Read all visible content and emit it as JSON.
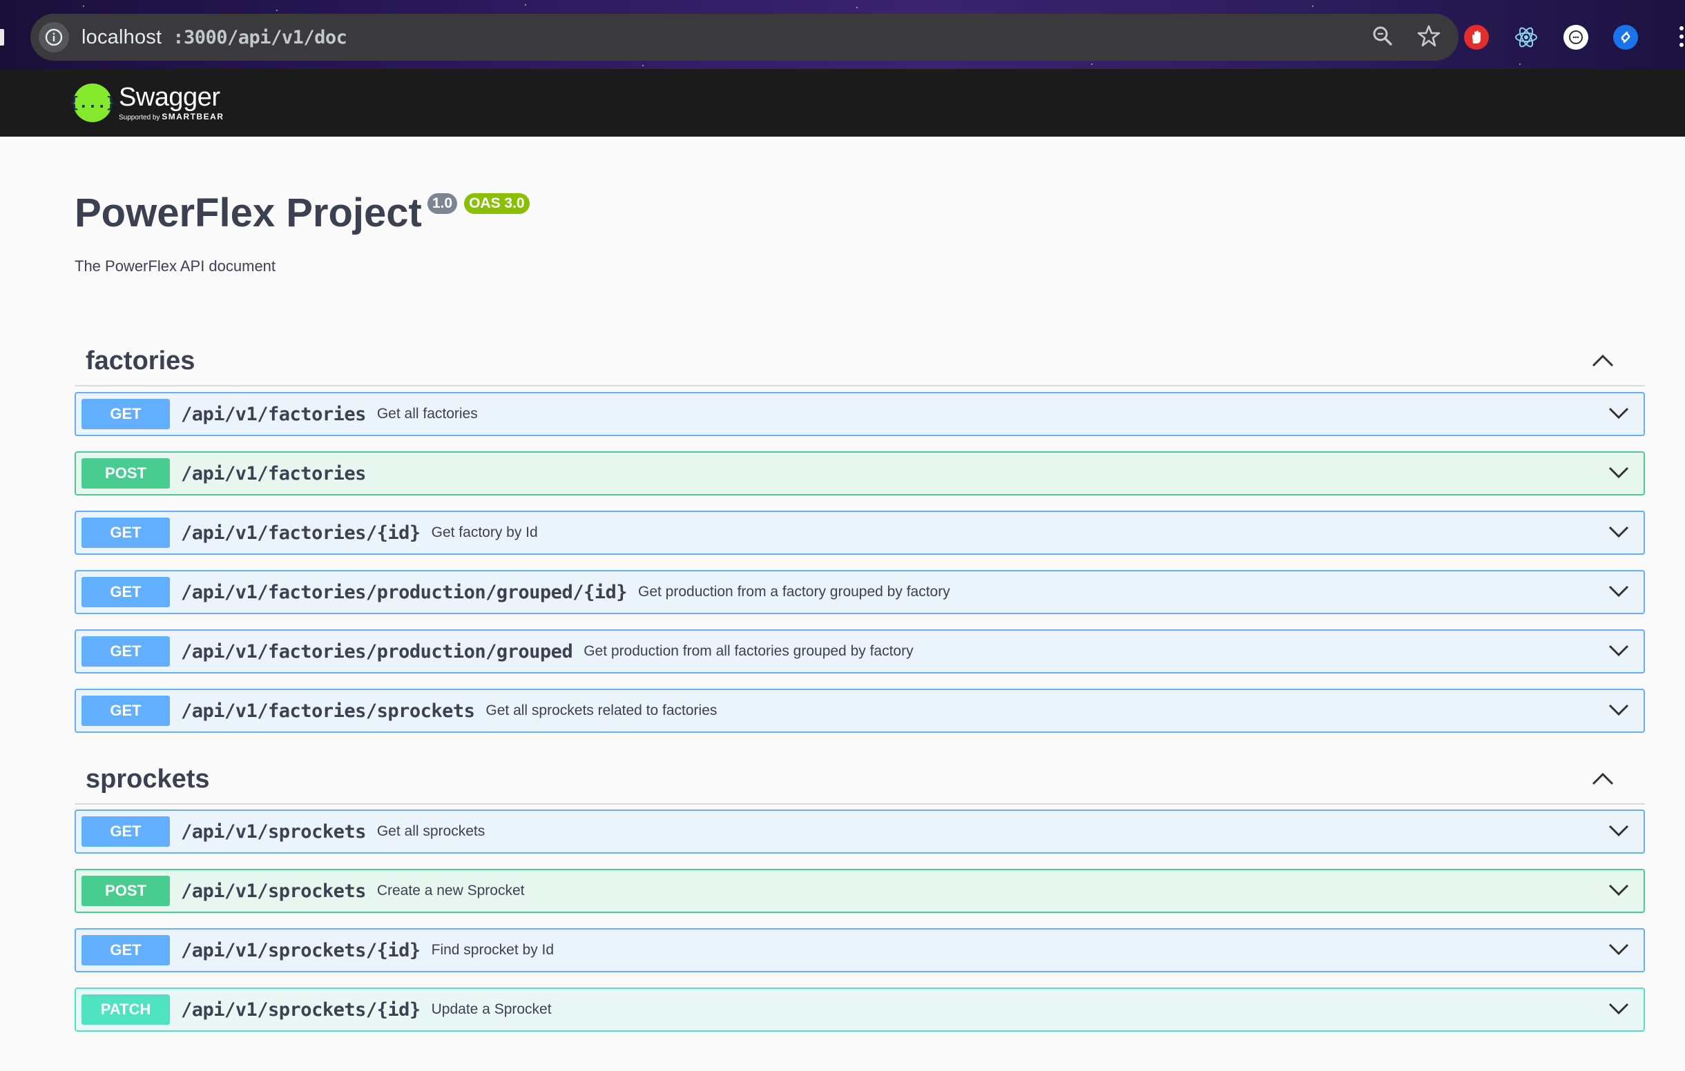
{
  "browser": {
    "url_host": "localhost",
    "url_path": ":3000/api/v1/doc"
  },
  "topbar": {
    "logo_glyph": "{...}",
    "logo_name": "Swagger",
    "logo_sub_prefix": "Supported by",
    "logo_sub_brand": "SMARTBEAR"
  },
  "info": {
    "title": "PowerFlex Project",
    "version": "1.0",
    "oas": "OAS 3.0",
    "description": "The PowerFlex API document"
  },
  "tags": [
    {
      "name": "factories",
      "operations": [
        {
          "method": "GET",
          "path": "/api/v1/factories",
          "summary": "Get all factories"
        },
        {
          "method": "POST",
          "path": "/api/v1/factories",
          "summary": ""
        },
        {
          "method": "GET",
          "path": "/api/v1/factories/{id}",
          "summary": "Get factory by Id"
        },
        {
          "method": "GET",
          "path": "/api/v1/factories/production/grouped/{id}",
          "summary": "Get production from a factory grouped by factory"
        },
        {
          "method": "GET",
          "path": "/api/v1/factories/production/grouped",
          "summary": "Get production from all factories grouped by factory"
        },
        {
          "method": "GET",
          "path": "/api/v1/factories/sprockets",
          "summary": "Get all sprockets related to factories"
        }
      ]
    },
    {
      "name": "sprockets",
      "operations": [
        {
          "method": "GET",
          "path": "/api/v1/sprockets",
          "summary": "Get all sprockets"
        },
        {
          "method": "POST",
          "path": "/api/v1/sprockets",
          "summary": "Create a new Sprocket"
        },
        {
          "method": "GET",
          "path": "/api/v1/sprockets/{id}",
          "summary": "Find sprocket by Id"
        },
        {
          "method": "PATCH",
          "path": "/api/v1/sprockets/{id}",
          "summary": "Update a Sprocket"
        }
      ]
    }
  ],
  "colors": {
    "get": "#61affe",
    "post": "#49cc90",
    "patch": "#50e3c2",
    "version_badge": "#7d8492",
    "oas_badge": "#89bf04",
    "topbar": "#1b1b1b"
  }
}
